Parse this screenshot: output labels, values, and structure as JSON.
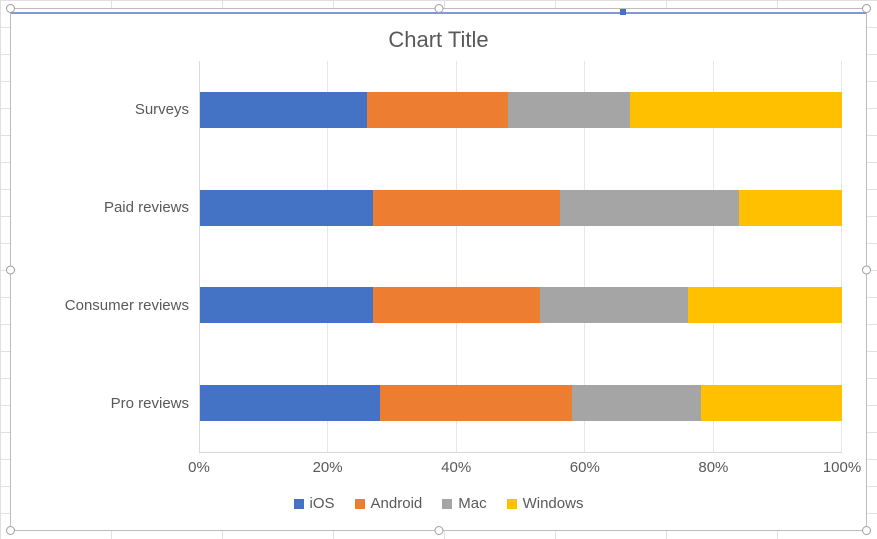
{
  "chart_data": {
    "type": "bar",
    "orientation": "horizontal-stacked-100",
    "title": "Chart Title",
    "xlabel": "",
    "ylabel": "",
    "xlim": [
      0,
      100
    ],
    "x_ticks": [
      "0%",
      "20%",
      "40%",
      "60%",
      "80%",
      "100%"
    ],
    "categories": [
      "Surveys",
      "Paid reviews",
      "Consumer reviews",
      "Pro reviews"
    ],
    "series": [
      {
        "name": "iOS",
        "color": "#4472c4",
        "values": [
          26,
          27,
          27,
          28
        ]
      },
      {
        "name": "Android",
        "color": "#ed7d31",
        "values": [
          22,
          29,
          26,
          30
        ]
      },
      {
        "name": "Mac",
        "color": "#a5a5a5",
        "values": [
          19,
          28,
          23,
          20
        ]
      },
      {
        "name": "Windows",
        "color": "#ffc000",
        "values": [
          33,
          16,
          24,
          22
        ]
      }
    ],
    "legend_position": "bottom",
    "grid": true
  },
  "ui": {
    "selected": true
  }
}
